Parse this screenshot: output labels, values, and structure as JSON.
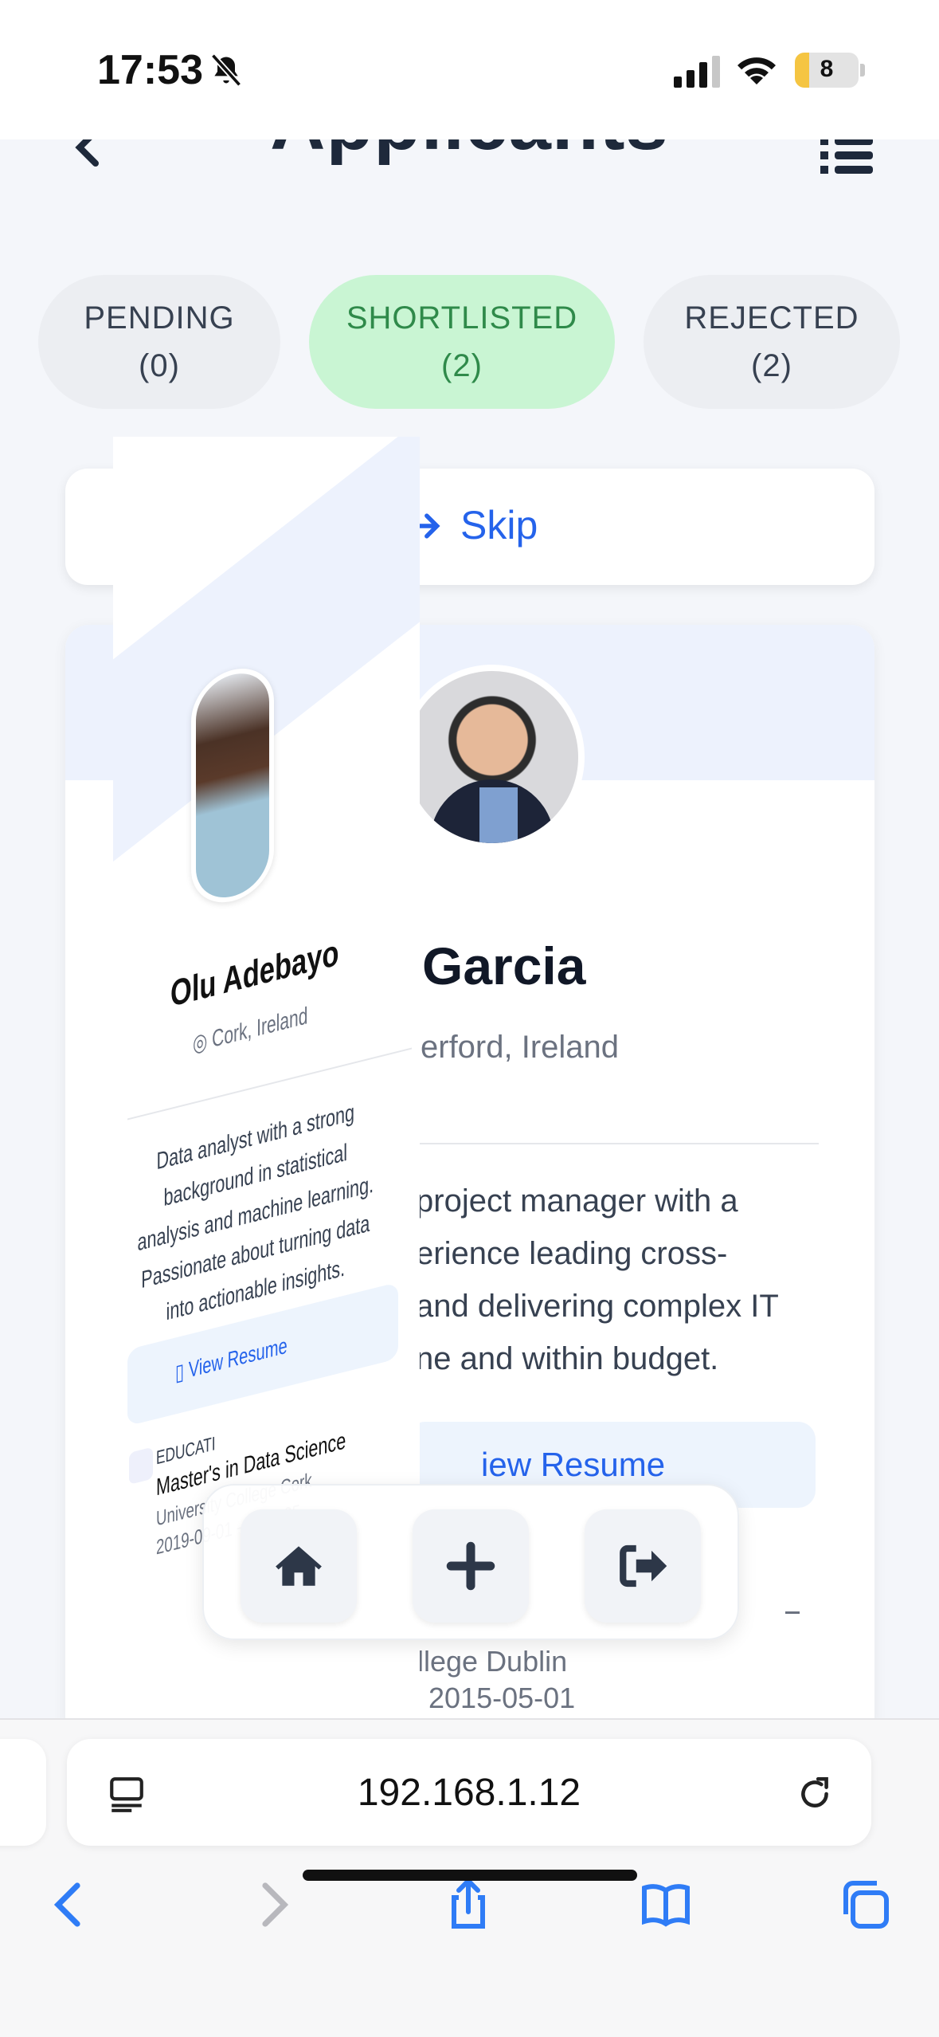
{
  "status": {
    "time": "17:53",
    "battery": "8",
    "battery_level": 0.08
  },
  "header": {
    "title": "Applicants"
  },
  "tabs": [
    {
      "label": "PENDING",
      "count": "(0)"
    },
    {
      "label": "SHORTLISTED",
      "count": "(2)"
    },
    {
      "label": "REJECTED",
      "count": "(2)"
    }
  ],
  "skip": {
    "label": "Skip"
  },
  "current_card": {
    "name": "Garcia",
    "location": "erford, Ireland",
    "bio_lines": [
      "project manager with a",
      "erience leading cross-",
      "and delivering complex IT",
      "ne and within budget."
    ],
    "resume_label": "iew Resume",
    "school": "llege Dublin",
    "date": "2015-05-01"
  },
  "swiped_card": {
    "name": "Olu Adebayo",
    "location": "Cork, Ireland",
    "bio": "Data analyst with a strong background in statistical analysis and machine learning. Passionate about turning data into actionable insights.",
    "resume_label": "View Resume",
    "edu_label": "EDUCATI",
    "degree": "Master's in Data Science",
    "university": "University College Cork",
    "dates": "2019-09-01 - 2021-05"
  },
  "browser": {
    "url": "192.168.1.12"
  },
  "colors": {
    "accent_blue": "#2563eb",
    "shortlisted_bg": "#c9f5d3",
    "shortlisted_text": "#2f8a4a",
    "banner": "#edf2fd"
  }
}
